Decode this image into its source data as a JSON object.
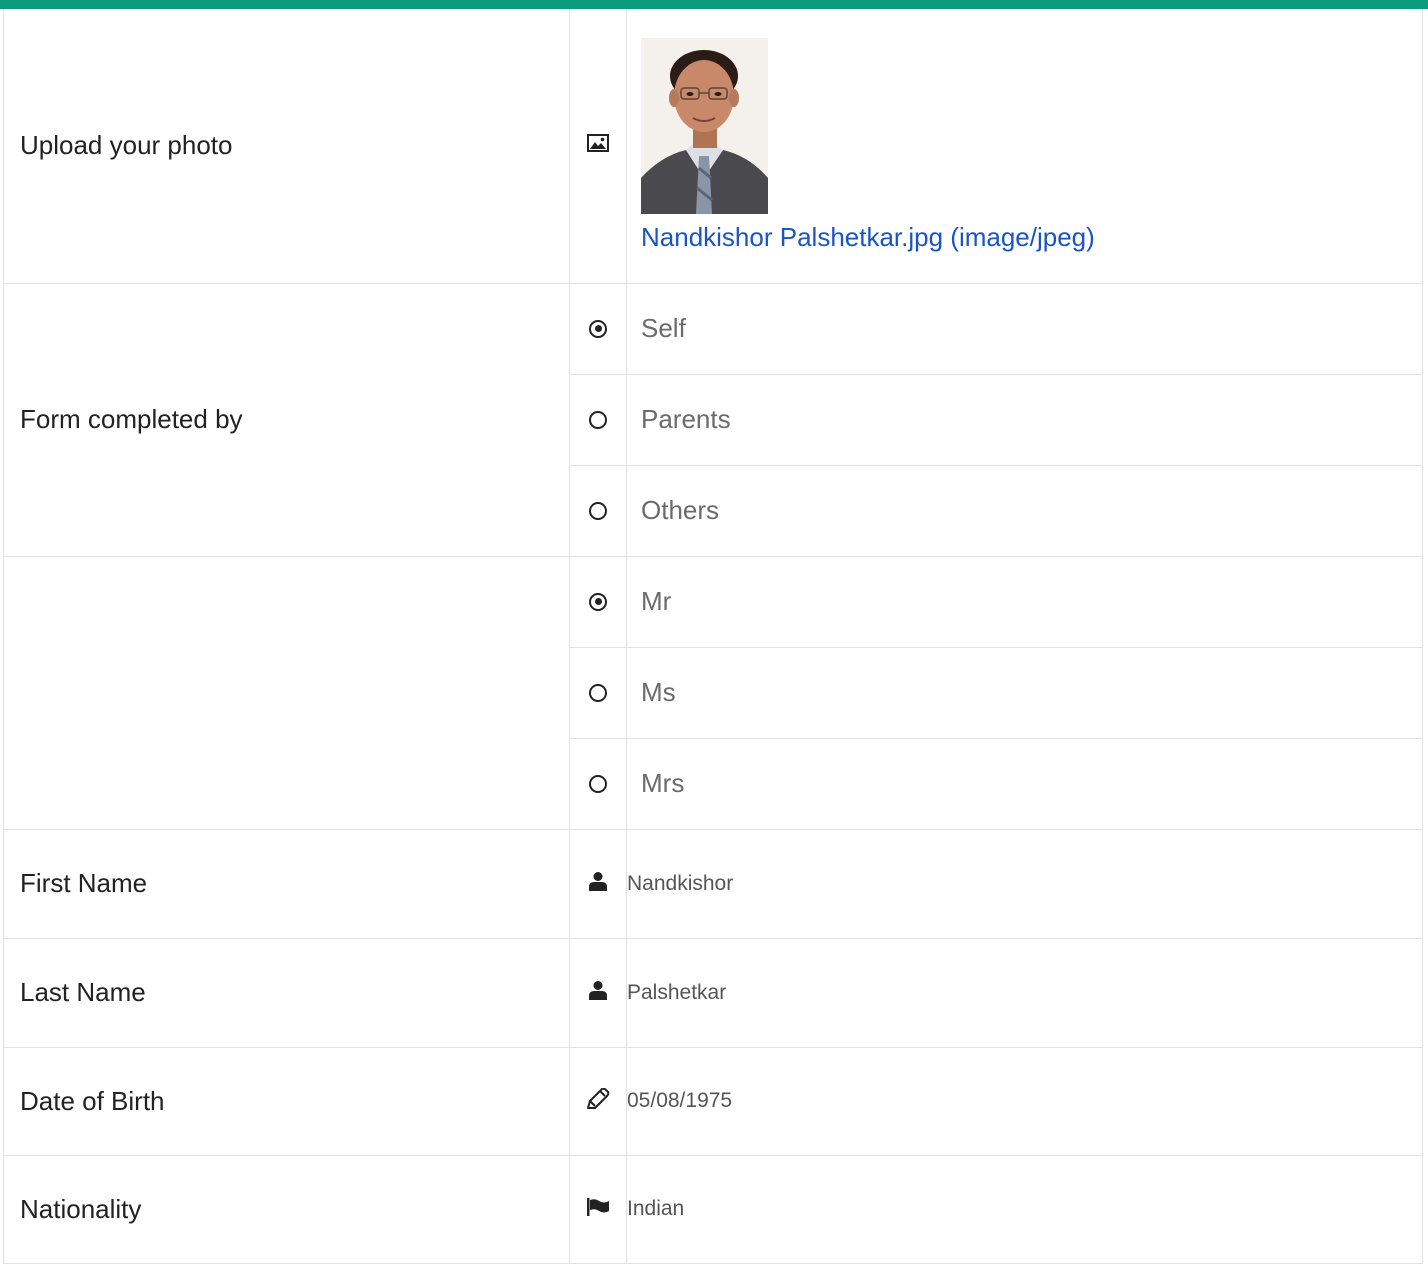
{
  "photo_row": {
    "label": "Upload your photo",
    "icon": "image-icon",
    "file_link": "Nandkishor Palshetkar.jpg (image/jpeg)"
  },
  "completed_by": {
    "label": "Form completed by",
    "options": [
      {
        "label": "Self",
        "checked": true
      },
      {
        "label": "Parents",
        "checked": false
      },
      {
        "label": "Others",
        "checked": false
      }
    ]
  },
  "title": {
    "label": "",
    "options": [
      {
        "label": "Mr",
        "checked": true
      },
      {
        "label": "Ms",
        "checked": false
      },
      {
        "label": "Mrs",
        "checked": false
      }
    ]
  },
  "first_name": {
    "label": "First Name",
    "icon": "user-icon",
    "value": "Nandkishor"
  },
  "last_name": {
    "label": "Last Name",
    "icon": "user-icon",
    "value": "Palshetkar"
  },
  "dob": {
    "label": "Date of Birth",
    "icon": "pen-icon",
    "value": "05/08/1975"
  },
  "nationality": {
    "label": "Nationality",
    "icon": "flag-icon",
    "value": "Indian"
  },
  "colors": {
    "accent_bar": "#0b9a7c",
    "link": "#1a55c6"
  }
}
